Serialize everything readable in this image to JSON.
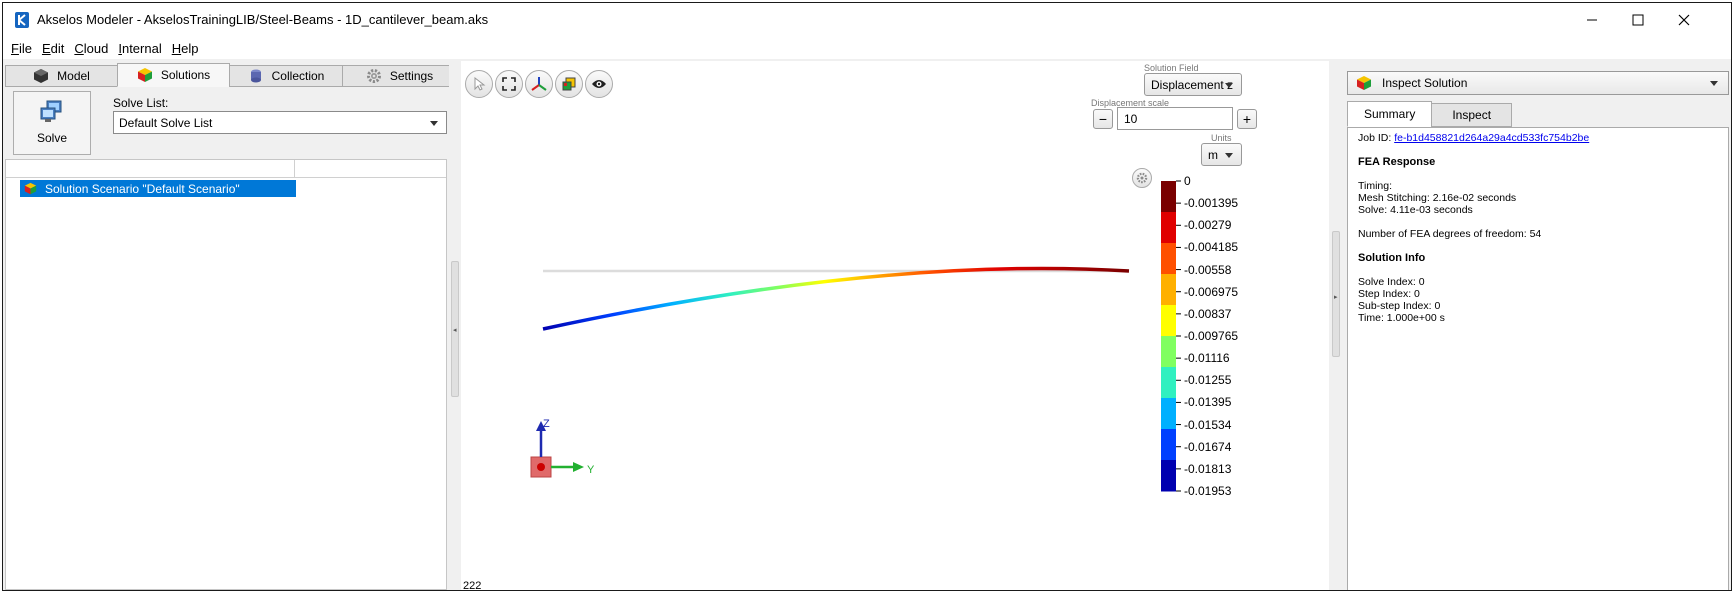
{
  "window": {
    "title": "Akselos Modeler - AkselosTrainingLIB/Steel-Beams - 1D_cantilever_beam.aks",
    "controls": [
      "minimize-icon",
      "maximize-icon",
      "close-icon"
    ]
  },
  "menu": [
    {
      "accel": "F",
      "rest": "ile"
    },
    {
      "accel": "E",
      "rest": "dit"
    },
    {
      "accel": "C",
      "rest": "loud"
    },
    {
      "accel": "I",
      "rest": "nternal"
    },
    {
      "accel": "H",
      "rest": "elp"
    }
  ],
  "left_tabs": [
    {
      "label": "Model",
      "icon": "cube-icon"
    },
    {
      "label": "Solutions",
      "icon": "solutions-icon",
      "active": true
    },
    {
      "label": "Collection",
      "icon": "collection-icon"
    },
    {
      "label": "Settings",
      "icon": "gear-icon"
    }
  ],
  "solve": {
    "button_label": "Solve",
    "list_label": "Solve List:",
    "list_value": "Default Solve List"
  },
  "tree": {
    "selected_item": "Solution Scenario \"Default Scenario\""
  },
  "viewport": {
    "solution_field_label": "Solution Field",
    "solution_field_value": "Displacement z",
    "displacement_scale_label": "Displacement scale",
    "displacement_scale_value": "10",
    "minus_label": "−",
    "plus_label": "+",
    "units_label": "Units",
    "units_value": "m",
    "corner_text": "222",
    "axis_z_label": "Z",
    "axis_y_label": "Y"
  },
  "colors": {
    "selection": "#0078d7",
    "link": "#0000ee",
    "colormap": [
      "#0000b0",
      "#0040ff",
      "#00b0ff",
      "#30f0c0",
      "#80ff60",
      "#ffff00",
      "#ffb000",
      "#ff5000",
      "#e00000",
      "#7a0000"
    ]
  },
  "chart_data": {
    "type": "heatmap",
    "legend_ticks": [
      "0",
      "-0.001395",
      "-0.00279",
      "-0.004185",
      "-0.00558",
      "-0.006975",
      "-0.00837",
      "-0.009765",
      "-0.01116",
      "-0.01255",
      "-0.01395",
      "-0.01534",
      "-0.01674",
      "-0.01813",
      "-0.01953"
    ],
    "range": [
      -0.01953,
      0
    ]
  },
  "inspect": {
    "title": "Inspect Solution",
    "tabs": [
      "Summary",
      "Inspect"
    ],
    "job_id_label": "Job ID:",
    "job_id": "fe-b1d458821d264a29a4cd533fc754b2be",
    "fea_response_heading": "FEA Response",
    "timing_label": "Timing:",
    "mesh_stitching": "Mesh Stitching: 2.16e-02 seconds",
    "solve_time": "Solve: 4.11e-03 seconds",
    "dof": "Number of FEA degrees of freedom: 54",
    "solution_info_heading": "Solution Info",
    "solve_index": "Solve Index: 0",
    "step_index": "Step Index: 0",
    "substep_index": "Sub-step Index: 0",
    "time": "Time: 1.000e+00 s"
  }
}
